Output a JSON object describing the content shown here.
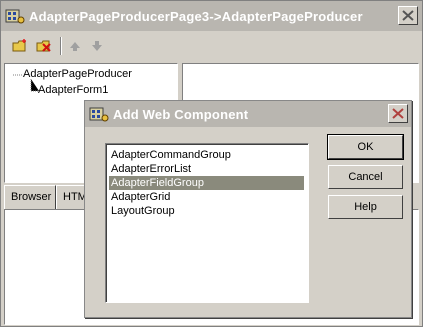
{
  "main_window": {
    "title": "AdapterPageProducerPage3->AdapterPageProducer",
    "toolbar": {
      "items": [
        {
          "name": "new-item",
          "icon": "folder-new-icon"
        },
        {
          "name": "delete-item",
          "icon": "folder-delete-icon"
        },
        {
          "name": "move-up",
          "icon": "arrow-up-icon"
        },
        {
          "name": "move-down",
          "icon": "arrow-down-icon"
        }
      ]
    },
    "tree": {
      "items": [
        {
          "label": "AdapterPageProducer"
        },
        {
          "label": "AdapterForm1"
        }
      ]
    },
    "tabs": [
      {
        "label": "Browser"
      },
      {
        "label": "HTM"
      }
    ]
  },
  "dialog": {
    "title": "Add Web Component",
    "components": [
      {
        "label": "AdapterCommandGroup"
      },
      {
        "label": "AdapterErrorList"
      },
      {
        "label": "AdapterFieldGroup",
        "selected": true
      },
      {
        "label": "AdapterGrid"
      },
      {
        "label": "LayoutGroup"
      }
    ],
    "buttons": {
      "ok": "OK",
      "cancel": "Cancel",
      "help": "Help"
    }
  },
  "colors": {
    "titlebar_inactive": "#b9b6b0",
    "face": "#d4d0c8",
    "selection": "#8a8a7c",
    "close_x": "#b0413e"
  }
}
